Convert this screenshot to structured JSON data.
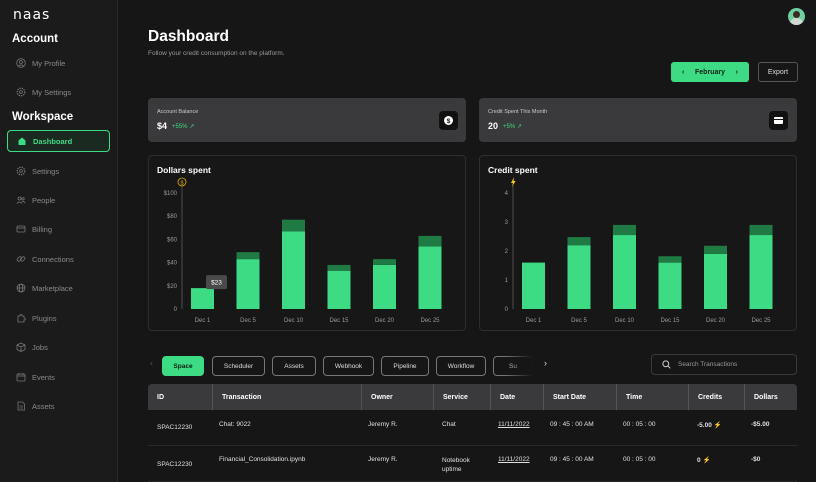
{
  "app": {
    "logo": "naas"
  },
  "sidebar": {
    "account_heading": "Account",
    "account_items": [
      {
        "label": "My Profile",
        "icon": "user-icon"
      },
      {
        "label": "My Settings",
        "icon": "settings-icon"
      }
    ],
    "workspace_heading": "Workspace",
    "workspace_items": [
      {
        "label": "Dashboard",
        "icon": "home-icon",
        "active": true
      },
      {
        "label": "Settings",
        "icon": "gear-icon"
      },
      {
        "label": "People",
        "icon": "people-icon"
      },
      {
        "label": "Billing",
        "icon": "card-icon"
      },
      {
        "label": "Connections",
        "icon": "link-icon"
      },
      {
        "label": "Marketplace",
        "icon": "globe-icon"
      },
      {
        "label": "Plugins",
        "icon": "puzzle-icon"
      },
      {
        "label": "Jobs",
        "icon": "box-icon"
      },
      {
        "label": "Events",
        "icon": "calendar-icon"
      },
      {
        "label": "Assets",
        "icon": "file-icon"
      }
    ]
  },
  "header": {
    "title": "Dashboard",
    "subtitle": "Follow your credit consumption on the platform.",
    "month": "February",
    "export_label": "Export"
  },
  "stats": [
    {
      "label": "Account Balance",
      "value": "$4",
      "delta": "+55%",
      "icon": "dollar-icon"
    },
    {
      "label": "Credit Spent This Month",
      "value": "20",
      "delta": "+5%",
      "icon": "wallet-icon"
    }
  ],
  "colors": {
    "accent": "#3ddc84",
    "accent_dark": "#1f7a44",
    "panel": "#3a3a3c"
  },
  "chart_data": [
    {
      "type": "bar",
      "title": "Dollars spent",
      "categories": [
        "Dec 1",
        "Dec 5",
        "Dec 10",
        "Dec 15",
        "Dec 20",
        "Dec 25"
      ],
      "tick_labels": [
        "0",
        "$20",
        "$40",
        "$60",
        "$80",
        "$100"
      ],
      "ylim": [
        0,
        100
      ],
      "series": [
        {
          "values": [
            18,
            43,
            67,
            33,
            38,
            54
          ]
        },
        {
          "values": [
            0,
            6,
            10,
            5,
            5,
            9
          ]
        }
      ],
      "tooltip": {
        "category": "Dec 1",
        "text": "$23"
      },
      "axis_icon": "dollar-icon"
    },
    {
      "type": "bar",
      "title": "Credit spent",
      "categories": [
        "Dec 1",
        "Dec 5",
        "Dec 10",
        "Dec 15",
        "Dec 20",
        "Dec 25"
      ],
      "tick_labels": [
        "0",
        "1",
        "2",
        "3",
        "4"
      ],
      "ylim": [
        0,
        4
      ],
      "series": [
        {
          "values": [
            1.6,
            2.2,
            2.55,
            1.6,
            1.9,
            2.55
          ]
        },
        {
          "values": [
            0,
            0.28,
            0.35,
            0.22,
            0.28,
            0.35
          ]
        }
      ],
      "axis_icon": "bolt-icon"
    }
  ],
  "filters": {
    "items": [
      "Space",
      "Scheduler",
      "Assets",
      "Webhook",
      "Pipeline",
      "Workflow",
      "Su"
    ],
    "active": "Space",
    "search_placeholder": "Search Transactions"
  },
  "table": {
    "columns": [
      "ID",
      "Transaction",
      "Owner",
      "Service",
      "Date",
      "Start Date",
      "Time",
      "Credits",
      "Dollars"
    ],
    "rows": [
      [
        "SPAC12230",
        "Chat: 9022",
        "Jeremy R.",
        "Chat",
        "11/11/2022",
        "09 : 45 : 00 AM",
        "00 : 05 : 00",
        "-5.00",
        "-$5.00"
      ],
      [
        "SPAC12230",
        "Financial_Consolidation.ipynb",
        "Jeremy R.",
        "Notebook uptime",
        "11/11/2022",
        "09 : 45 : 00 AM",
        "00 : 05 : 00",
        "0",
        "-$0"
      ]
    ]
  }
}
